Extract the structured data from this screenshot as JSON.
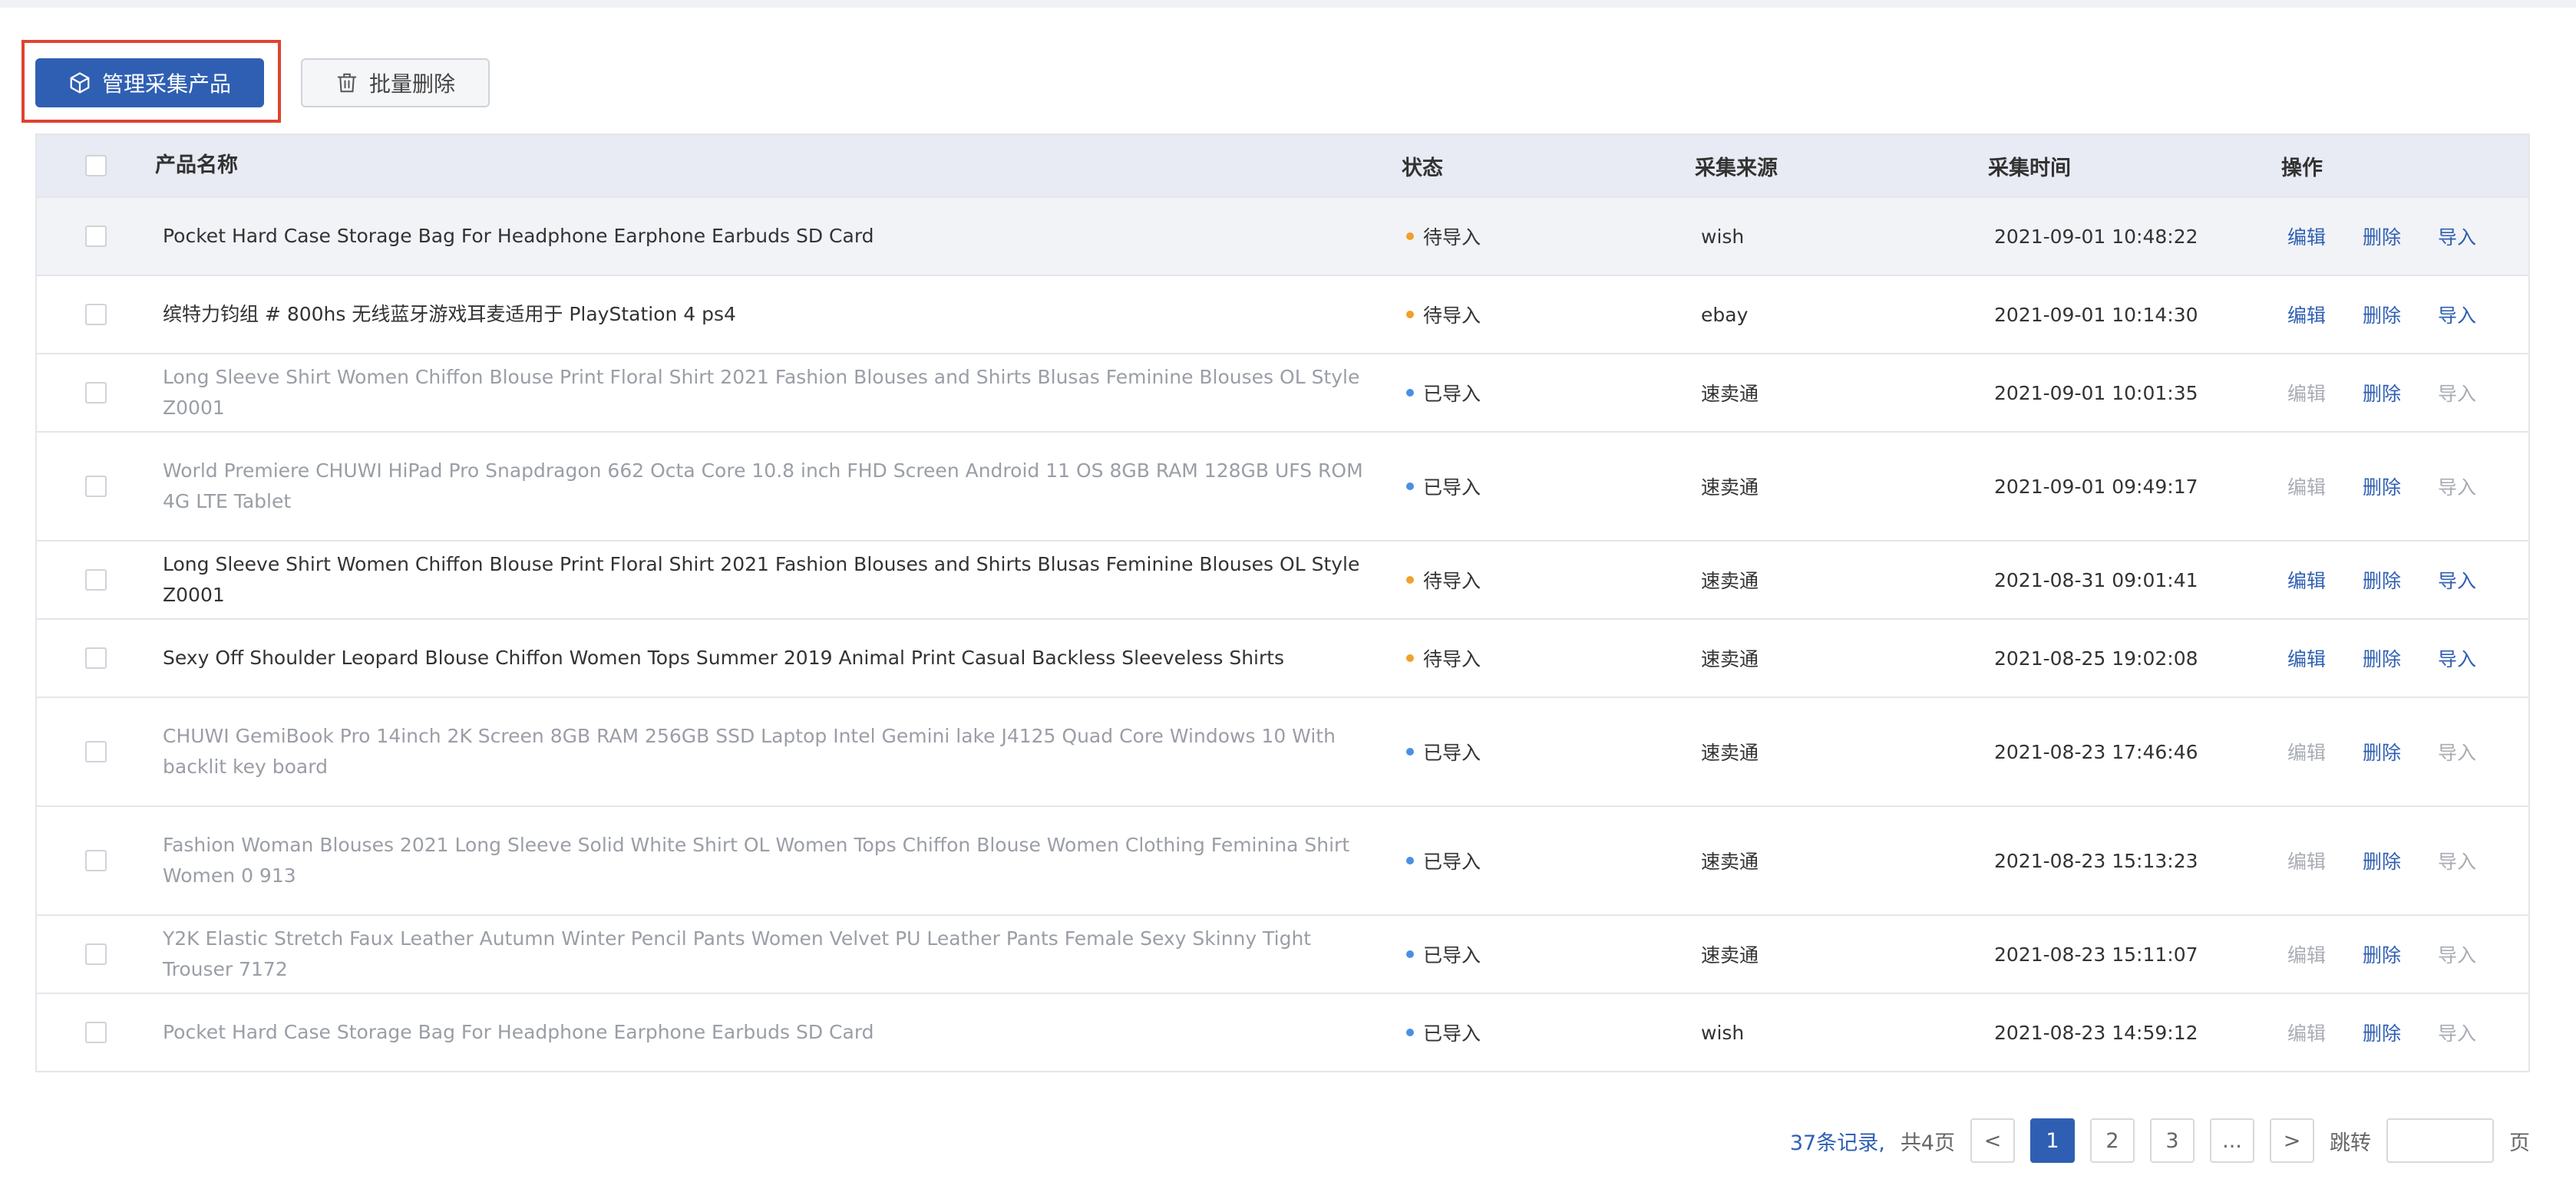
{
  "toolbar": {
    "manage_label": "管理采集产品",
    "batch_delete_label": "批量删除",
    "manage_icon": "cube-icon",
    "batch_delete_icon": "trash-icon",
    "highlight_color": "#e0432f"
  },
  "table": {
    "headers": {
      "name": "产品名称",
      "status": "状态",
      "source": "采集来源",
      "time": "采集时间",
      "ops": "操作"
    },
    "rows": [
      {
        "name": "Pocket Hard Case Storage Bag For Headphone Earphone Earbuds SD Card",
        "status": "待导入",
        "source": "wish",
        "time": "2021-09-01 10:48:22",
        "edit": "编辑",
        "delete": "删除",
        "import": "导入"
      },
      {
        "name": "缤特力钧组 # 800hs 无线蓝牙游戏耳麦适用于 PlayStation 4 ps4",
        "status": "待导入",
        "source": "ebay",
        "time": "2021-09-01 10:14:30",
        "edit": "编辑",
        "delete": "删除",
        "import": "导入"
      },
      {
        "name": "Long Sleeve Shirt Women Chiffon Blouse Print Floral Shirt 2021 Fashion Blouses and Shirts Blusas Feminine Blouses OL Style Z0001",
        "status": "已导入",
        "source": "速卖通",
        "time": "2021-09-01 10:01:35",
        "edit": "编辑",
        "delete": "删除",
        "import": "导入"
      },
      {
        "name": "World Premiere CHUWI HiPad Pro Snapdragon 662 Octa Core 10.8 inch FHD Screen Android 11 OS 8GB RAM 128GB UFS ROM 4G LTE Tablet",
        "status": "已导入",
        "source": "速卖通",
        "time": "2021-09-01 09:49:17",
        "edit": "编辑",
        "delete": "删除",
        "import": "导入"
      },
      {
        "name": "Long Sleeve Shirt Women Chiffon Blouse Print Floral Shirt 2021 Fashion Blouses and Shirts Blusas Feminine Blouses OL Style Z0001",
        "status": "待导入",
        "source": "速卖通",
        "time": "2021-08-31 09:01:41",
        "edit": "编辑",
        "delete": "删除",
        "import": "导入"
      },
      {
        "name": "Sexy Off Shoulder Leopard Blouse Chiffon Women Tops Summer 2019 Animal Print Casual Backless Sleeveless Shirts",
        "status": "待导入",
        "source": "速卖通",
        "time": "2021-08-25 19:02:08",
        "edit": "编辑",
        "delete": "删除",
        "import": "导入"
      },
      {
        "name": "CHUWI GemiBook Pro 14inch 2K Screen 8GB RAM 256GB SSD Laptop Intel Gemini lake J4125 Quad Core Windows 10 With backlit key board",
        "status": "已导入",
        "source": "速卖通",
        "time": "2021-08-23 17:46:46",
        "edit": "编辑",
        "delete": "删除",
        "import": "导入"
      },
      {
        "name": "Fashion Woman Blouses 2021 Long Sleeve Solid White Shirt OL Women Tops Chiffon Blouse Women Clothing Feminina Shirt Women 0 913",
        "status": "已导入",
        "source": "速卖通",
        "time": "2021-08-23 15:13:23",
        "edit": "编辑",
        "delete": "删除",
        "import": "导入"
      },
      {
        "name": "Y2K Elastic Stretch Faux Leather Autumn Winter Pencil Pants Women Velvet PU Leather Pants Female Sexy Skinny Tight Trouser 7172",
        "status": "已导入",
        "source": "速卖通",
        "time": "2021-08-23 15:11:07",
        "edit": "编辑",
        "delete": "删除",
        "import": "导入"
      },
      {
        "name": "Pocket Hard Case Storage Bag For Headphone Earphone Earbuds SD Card",
        "status": "已导入",
        "source": "wish",
        "time": "2021-08-23 14:59:12",
        "edit": "编辑",
        "delete": "删除",
        "import": "导入"
      }
    ],
    "status_colors": {
      "pending": "#f0a02c",
      "imported": "#4a90e2"
    }
  },
  "pagination": {
    "total": "37条记录,",
    "pages": "共4页",
    "prev": "<",
    "page_1": "1",
    "page_2": "2",
    "page_3": "3",
    "ellipsis": "...",
    "next": ">",
    "jump_label": "跳转",
    "jump_value": "",
    "page_suffix": "页"
  }
}
